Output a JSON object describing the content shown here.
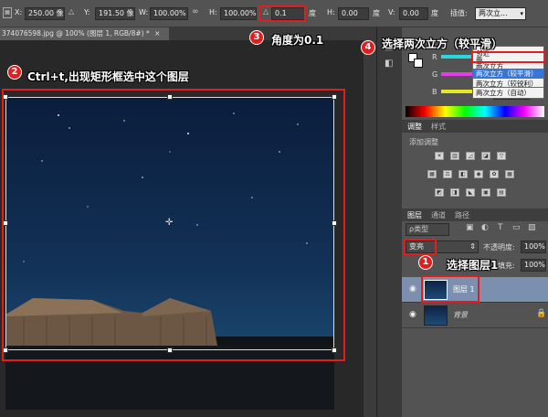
{
  "options_bar": {
    "x_label": "X:",
    "x_value": "250.00 像",
    "y_label": "Y:",
    "y_value": "191.50 像",
    "w_label": "W:",
    "w_value": "100.00%",
    "h_label": "H:",
    "h_value": "100.00%",
    "angle_value": "0.1",
    "angle_unit": "度",
    "hskew_label": "H:",
    "hskew_value": "0.00",
    "hskew_unit": "度",
    "vskew_label": "V:",
    "vskew_value": "0.00",
    "vskew_unit": "度",
    "interp_label": "插值:",
    "interp_value": "两次立..."
  },
  "document_tab": {
    "title": "374076598.jpg @ 100% (图层 1, RGB/8#) *",
    "close": "×"
  },
  "interp_dropdown": {
    "options": [
      "邻近",
      "两",
      "两次立方",
      "两次立方（较平滑）",
      "两次立方（较锐利）",
      "两次立方（自动）"
    ],
    "selected_index": 3
  },
  "color_panel": {
    "r_label": "R",
    "g_label": "G",
    "b_label": "B",
    "value": "255"
  },
  "adjustments_panel": {
    "tabs": [
      "调整",
      "样式"
    ],
    "add_label": "添加调整"
  },
  "layers_panel": {
    "tabs": [
      "图层",
      "通道",
      "路径"
    ],
    "filter_label": "ρ类型",
    "blend_mode": "变亮",
    "opacity_label": "不透明度:",
    "opacity_value": "100%",
    "fill_label": "填充:",
    "fill_value": "100%",
    "layers": [
      {
        "name": "图层 1",
        "selected": true
      },
      {
        "name": "背景",
        "selected": false
      }
    ]
  },
  "annotations": {
    "a1": {
      "num": "1",
      "text": "选择图层1"
    },
    "a2": {
      "num": "2",
      "text": "Ctrl+t,出现矩形框选中这个图层"
    },
    "a3": {
      "num": "3",
      "text": "角度为0.1"
    },
    "a4": {
      "num": "4",
      "text": "选择两次立方（较平滑）"
    }
  },
  "colors": {
    "annotation_red": "#e21d1d",
    "panel_gray": "#535353",
    "selection_blue": "#3875d7"
  }
}
